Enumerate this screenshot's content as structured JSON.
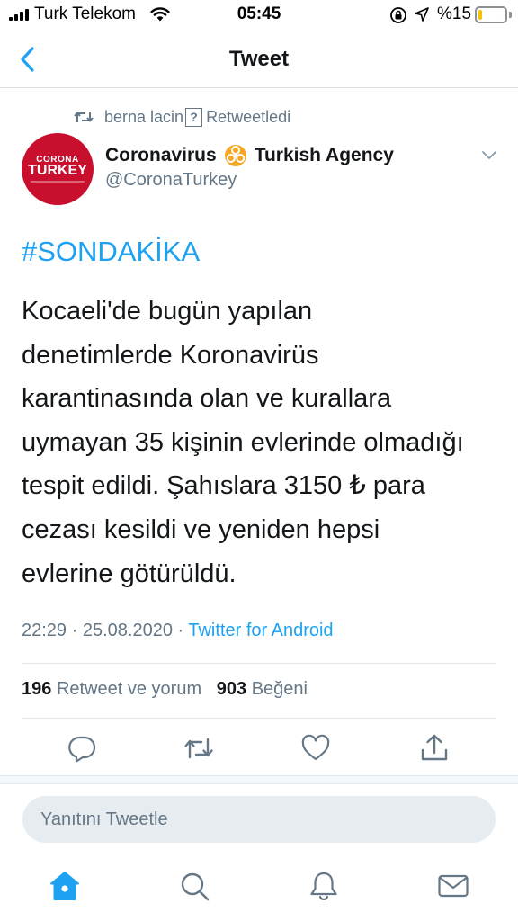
{
  "status_bar": {
    "carrier": "Turk Telekom",
    "time": "05:45",
    "battery_percent": "%15",
    "battery_level": 0.15
  },
  "nav": {
    "title": "Tweet"
  },
  "retweet": {
    "user": "berna lacin",
    "user_suffix_glyph": "?",
    "label": "Retweetledi"
  },
  "author": {
    "avatar_line1": "CORONA",
    "avatar_line2": "TURKEY",
    "name_part1": "Coronavirus",
    "name_part2": "Turkish Agency",
    "handle": "@CoronaTurkey"
  },
  "tweet": {
    "hashtag": "#SONDAKİKA",
    "lines": [
      "Kocaeli'de bugün yapılan",
      "denetimlerde Koronavirüs",
      "karantinasında olan ve kurallara",
      "uymayan 35 kişinin evlerinde olmadığı",
      "tespit edildi. Şahıslara 3150 ₺ para",
      "cezası kesildi ve yeniden hepsi",
      "evlerine götürüldü."
    ],
    "time": "22:29",
    "date": "25.08.2020",
    "source": "Twitter for Android"
  },
  "stats": {
    "retweets": "196",
    "retweets_label": "Retweet ve yorum",
    "likes": "903",
    "likes_label": "Beğeni"
  },
  "reply": {
    "placeholder": "Yanıtını Tweetle"
  },
  "colors": {
    "accent": "#1da1f2",
    "muted": "#657786",
    "text": "#14171a",
    "avatar_red": "#c8102e",
    "biohazard_orange": "#f5a623"
  },
  "icons": {
    "back": "chevron-left-icon",
    "retweet": "retweet-icon",
    "reply": "reply-icon",
    "like": "heart-icon",
    "share": "share-icon",
    "home": "home-icon",
    "search": "search-icon",
    "notifications": "bell-icon",
    "messages": "mail-icon"
  }
}
